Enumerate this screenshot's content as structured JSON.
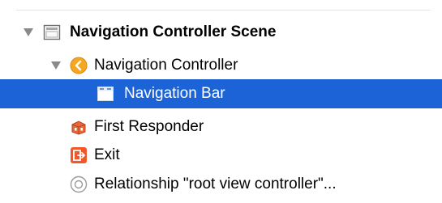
{
  "outline": {
    "items": [
      {
        "label": "Navigation Controller Scene",
        "icon": "scene-icon",
        "expanded": true,
        "selected": false,
        "bold": true
      },
      {
        "label": "Navigation Controller",
        "icon": "navigation-controller-icon",
        "expanded": true,
        "selected": false,
        "bold": false
      },
      {
        "label": "Navigation Bar",
        "icon": "navigation-bar-icon",
        "selected": true,
        "bold": false
      },
      {
        "label": "First Responder",
        "icon": "first-responder-icon",
        "selected": false,
        "bold": false
      },
      {
        "label": "Exit",
        "icon": "exit-icon",
        "selected": false,
        "bold": false
      },
      {
        "label": "Relationship \"root view controller\"...",
        "icon": "relationship-icon",
        "selected": false,
        "bold": false
      }
    ]
  },
  "colors": {
    "selection": "#1b63d6",
    "disclosure": "#8a8a8a",
    "navigation_controller_icon": "#f5a623",
    "first_responder_icon": "#e8683a",
    "exit_icon": "#f0582a"
  }
}
